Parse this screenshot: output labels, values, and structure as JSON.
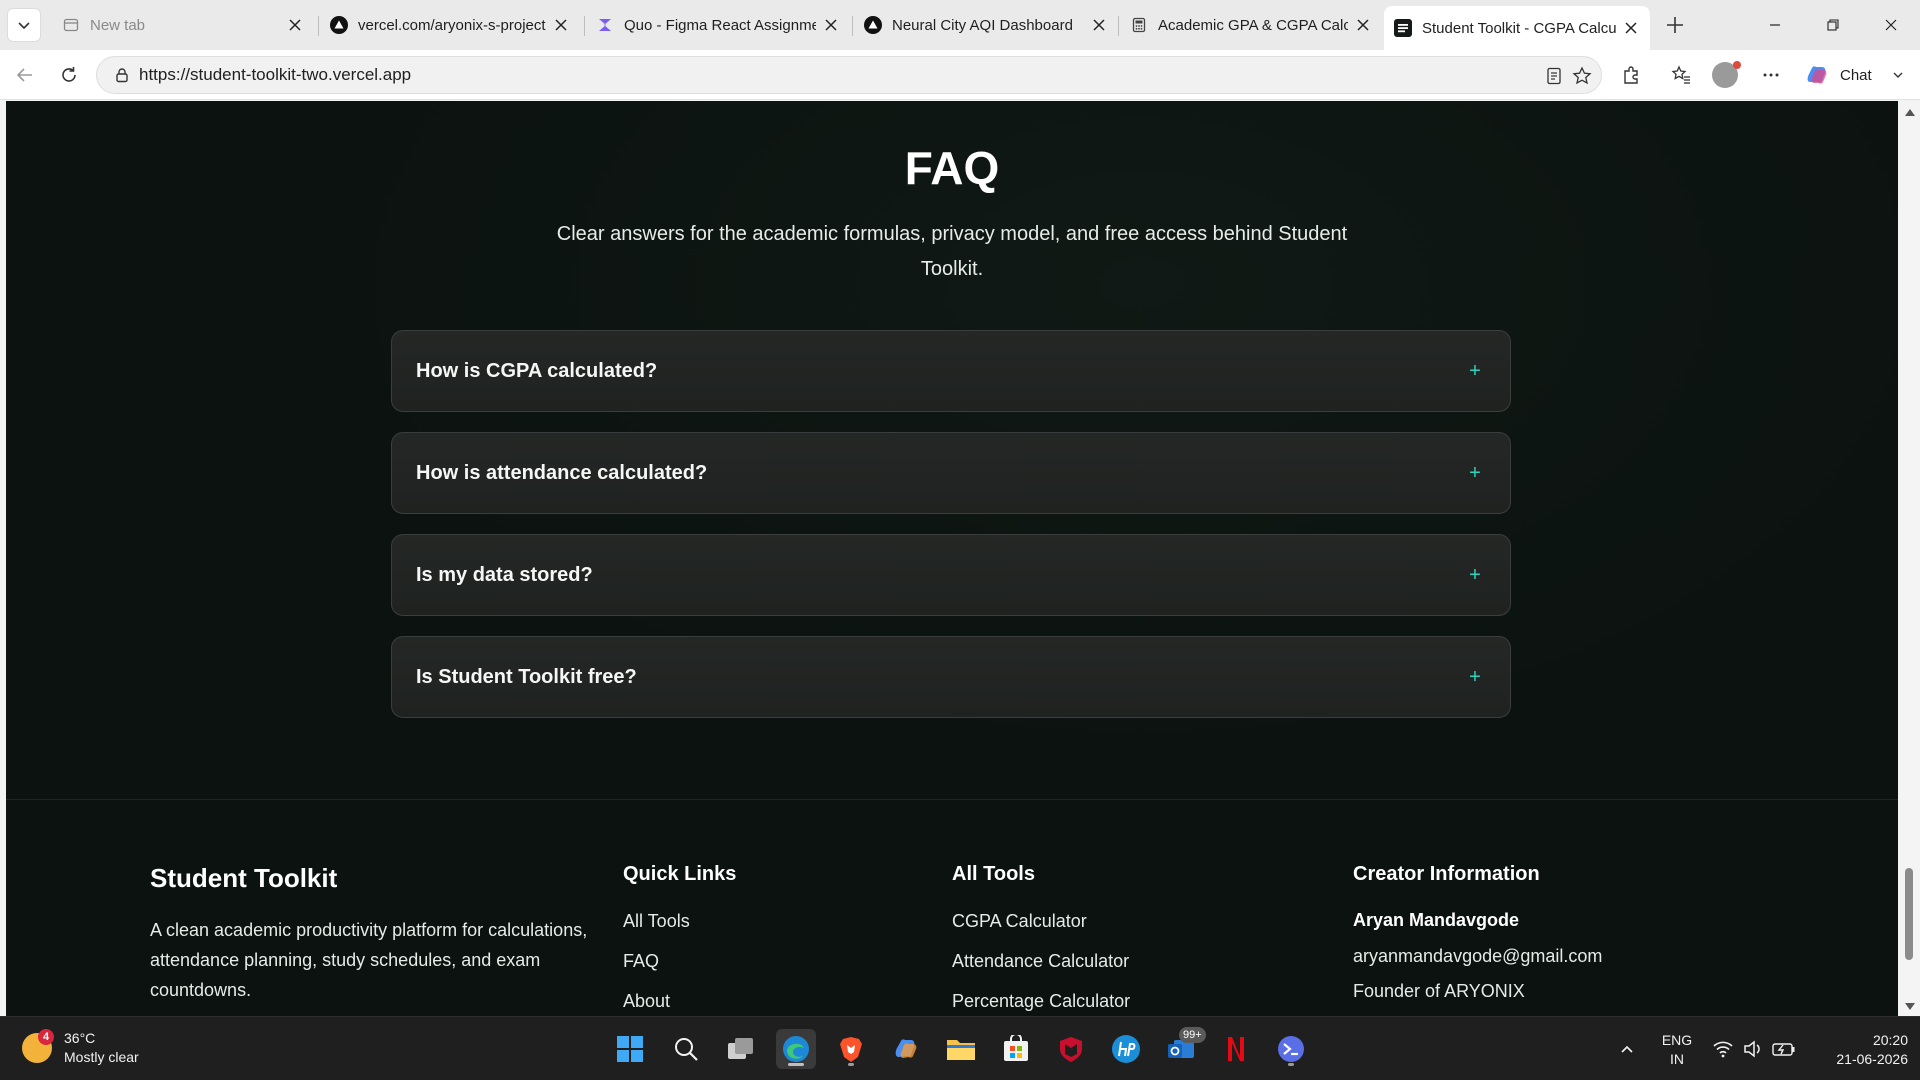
{
  "browser": {
    "tabs": [
      {
        "title": "New tab",
        "favicon": "newtab-icon",
        "dim": true
      },
      {
        "title": "vercel.com/aryonix-s-projects",
        "favicon": "vercel-icon"
      },
      {
        "title": "Quo - Figma React Assignment",
        "favicon": "quo-icon"
      },
      {
        "title": "Neural City AQI Dashboard",
        "favicon": "vercel-icon"
      },
      {
        "title": "Academic GPA & CGPA Calculator",
        "favicon": "calculator-icon"
      },
      {
        "title": "Student Toolkit - CGPA Calculator",
        "favicon": "toolkit-icon",
        "active": true
      }
    ],
    "url": "https://student-toolkit-two.vercel.app",
    "chat_label": "Chat"
  },
  "page": {
    "faq": {
      "title": "FAQ",
      "subtitle": "Clear answers for the academic formulas, privacy model, and free access behind Student Toolkit.",
      "items": [
        {
          "question": "How is CGPA calculated?"
        },
        {
          "question": "How is attendance calculated?"
        },
        {
          "question": "Is my data stored?"
        },
        {
          "question": "Is Student Toolkit free?"
        }
      ],
      "expand_symbol": "+"
    },
    "footer": {
      "brand": "Student Toolkit",
      "description": "A clean academic productivity platform for calculations, attendance planning, study schedules, and exam countdowns.",
      "quick_links": {
        "heading": "Quick Links",
        "links": [
          "All Tools",
          "FAQ",
          "About"
        ]
      },
      "all_tools": {
        "heading": "All Tools",
        "links": [
          "CGPA Calculator",
          "Attendance Calculator",
          "Percentage Calculator"
        ]
      },
      "creator": {
        "heading": "Creator Information",
        "name": "Aryan Mandavgode",
        "email": "aryanmandavgode@gmail.com",
        "role": "Founder of ARYONIX"
      }
    }
  },
  "taskbar": {
    "weather": {
      "temp": "36°C",
      "condition": "Mostly clear",
      "badge": "4"
    },
    "mail_badge": "99+",
    "lang_line1": "ENG",
    "lang_line2": "IN",
    "time": "20:20",
    "date": "21-06-2026"
  },
  "colors": {
    "page_bg": "#0b1210",
    "accent": "#2fd4c0",
    "card_bg": "#232624"
  }
}
